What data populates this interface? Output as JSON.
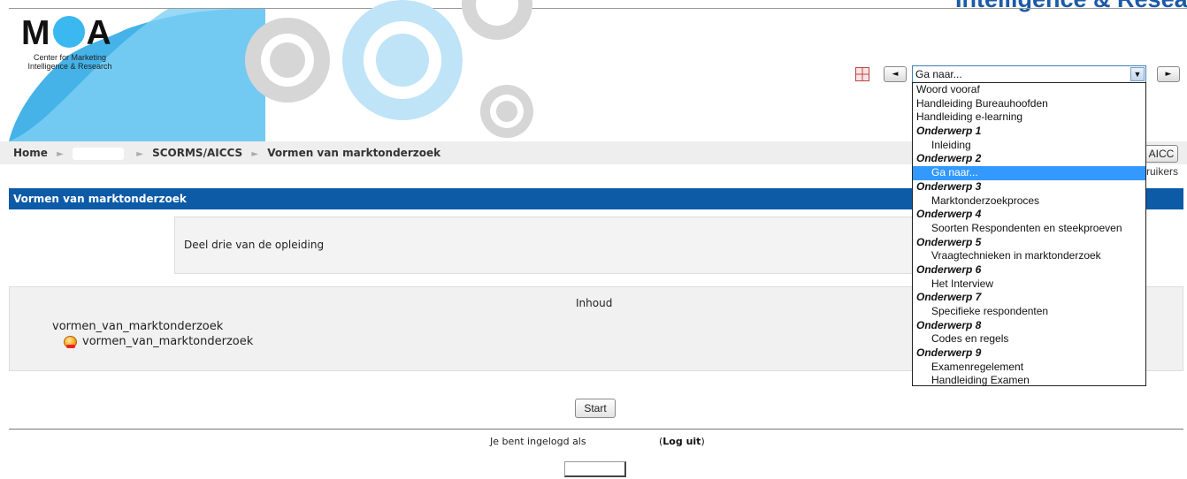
{
  "header": {
    "top_cut_text": "Intelligence & Resea",
    "logo": {
      "text_m": "M",
      "text_a": "A",
      "subtitle": "Center for Marketing Intelligence & Research"
    },
    "nav": {
      "prev_label": "◄",
      "next_label": "►",
      "select_value": "Ga naar..."
    }
  },
  "breadcrumb": {
    "home": "Home",
    "scorms": "SCORMS/AICCS",
    "current": "Vormen van marktonderzoek"
  },
  "right_controls": {
    "aicc_button": "AICC",
    "users_text": "ruikers"
  },
  "page": {
    "title": "Vormen van marktonderzoek",
    "intro": "Deel drie van de opleiding",
    "content_heading": "Inhoud",
    "item_title": "vormen_van_marktonderzoek",
    "item_sub": "vormen_van_marktonderzoek",
    "start_button": "Start"
  },
  "footer": {
    "login_text": "Je bent ingelogd als",
    "logout_label": "Log uit",
    "logout_open": "(",
    "logout_close": ")"
  },
  "dropdown": {
    "options": [
      {
        "label": "Woord vooraf",
        "kind": "item"
      },
      {
        "label": "Handleiding Bureauhoofden",
        "kind": "item"
      },
      {
        "label": "Handleiding e-learning",
        "kind": "item"
      },
      {
        "label": "Onderwerp 1",
        "kind": "group"
      },
      {
        "label": "Inleiding",
        "kind": "child"
      },
      {
        "label": "Onderwerp 2",
        "kind": "group"
      },
      {
        "label": "Ga naar...",
        "kind": "child",
        "selected": true
      },
      {
        "label": "Onderwerp 3",
        "kind": "group"
      },
      {
        "label": "Marktonderzoekproces",
        "kind": "child"
      },
      {
        "label": "Onderwerp 4",
        "kind": "group"
      },
      {
        "label": "Soorten Respondenten en steekproeven",
        "kind": "child"
      },
      {
        "label": "Onderwerp 5",
        "kind": "group"
      },
      {
        "label": "Vraagtechnieken in marktonderzoek",
        "kind": "child"
      },
      {
        "label": "Onderwerp 6",
        "kind": "group"
      },
      {
        "label": "Het Interview",
        "kind": "child"
      },
      {
        "label": "Onderwerp 7",
        "kind": "group"
      },
      {
        "label": "Specifieke respondenten",
        "kind": "child"
      },
      {
        "label": "Onderwerp 8",
        "kind": "group"
      },
      {
        "label": "Codes en regels",
        "kind": "child"
      },
      {
        "label": "Onderwerp 9",
        "kind": "group"
      },
      {
        "label": "Examenregelement",
        "kind": "child"
      },
      {
        "label": "Handleiding Examen",
        "kind": "child"
      }
    ]
  },
  "colors": {
    "brand_blue": "#0d5aa7",
    "logo_cyan": "#3ab8ef",
    "selected_highlight": "#3399ff"
  }
}
